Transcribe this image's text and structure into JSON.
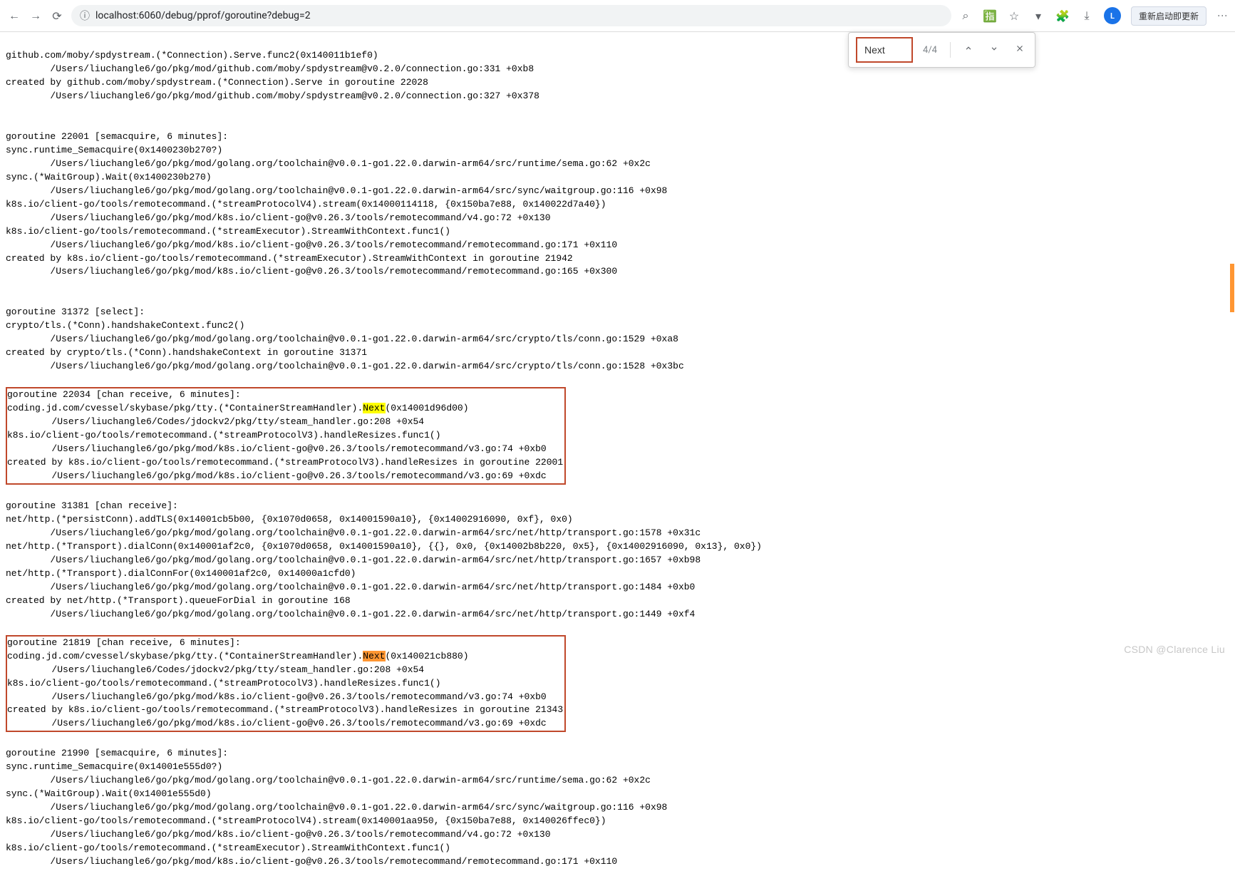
{
  "chrome": {
    "url": "localhost:6060/debug/pprof/goroutine?debug=2",
    "relaunch_label": "重新启动即更新"
  },
  "find": {
    "query": "Next",
    "count": "4/4"
  },
  "watermark": "CSDN @Clarence Liu",
  "blocks": {
    "g0": "github.com/moby/spdystream.(*Connection).Serve.func2(0x140011b1ef0)\n        /Users/liuchangle6/go/pkg/mod/github.com/moby/spdystream@v0.2.0/connection.go:331 +0xb8\ncreated by github.com/moby/spdystream.(*Connection).Serve in goroutine 22028\n        /Users/liuchangle6/go/pkg/mod/github.com/moby/spdystream@v0.2.0/connection.go:327 +0x378",
    "g1": "goroutine 22001 [semacquire, 6 minutes]:\nsync.runtime_Semacquire(0x1400230b270?)\n        /Users/liuchangle6/go/pkg/mod/golang.org/toolchain@v0.0.1-go1.22.0.darwin-arm64/src/runtime/sema.go:62 +0x2c\nsync.(*WaitGroup).Wait(0x1400230b270)\n        /Users/liuchangle6/go/pkg/mod/golang.org/toolchain@v0.0.1-go1.22.0.darwin-arm64/src/sync/waitgroup.go:116 +0x98\nk8s.io/client-go/tools/remotecommand.(*streamProtocolV4).stream(0x14000114118, {0x150ba7e88, 0x140022d7a40})\n        /Users/liuchangle6/go/pkg/mod/k8s.io/client-go@v0.26.3/tools/remotecommand/v4.go:72 +0x130\nk8s.io/client-go/tools/remotecommand.(*streamExecutor).StreamWithContext.func1()\n        /Users/liuchangle6/go/pkg/mod/k8s.io/client-go@v0.26.3/tools/remotecommand/remotecommand.go:171 +0x110\ncreated by k8s.io/client-go/tools/remotecommand.(*streamExecutor).StreamWithContext in goroutine 21942\n        /Users/liuchangle6/go/pkg/mod/k8s.io/client-go@v0.26.3/tools/remotecommand/remotecommand.go:165 +0x300",
    "g2": "goroutine 31372 [select]:\ncrypto/tls.(*Conn).handshakeContext.func2()\n        /Users/liuchangle6/go/pkg/mod/golang.org/toolchain@v0.0.1-go1.22.0.darwin-arm64/src/crypto/tls/conn.go:1529 +0xa8\ncreated by crypto/tls.(*Conn).handshakeContext in goroutine 31371\n        /Users/liuchangle6/go/pkg/mod/golang.org/toolchain@v0.0.1-go1.22.0.darwin-arm64/src/crypto/tls/conn.go:1528 +0x3bc",
    "g3_pre": "goroutine 22034 [chan receive, 6 minutes]:\ncoding.jd.com/cvessel/skybase/pkg/tty.(*ContainerStreamHandler).",
    "g3_hit": "Next",
    "g3_post": "(0x14001d96d00)\n        /Users/liuchangle6/Codes/jdockv2/pkg/tty/steam_handler.go:208 +0x54\nk8s.io/client-go/tools/remotecommand.(*streamProtocolV3).handleResizes.func1()\n        /Users/liuchangle6/go/pkg/mod/k8s.io/client-go@v0.26.3/tools/remotecommand/v3.go:74 +0xb0\ncreated by k8s.io/client-go/tools/remotecommand.(*streamProtocolV3).handleResizes in goroutine 22001\n        /Users/liuchangle6/go/pkg/mod/k8s.io/client-go@v0.26.3/tools/remotecommand/v3.go:69 +0xdc",
    "g4": "goroutine 31381 [chan receive]:\nnet/http.(*persistConn).addTLS(0x14001cb5b00, {0x1070d0658, 0x14001590a10}, {0x14002916090, 0xf}, 0x0)\n        /Users/liuchangle6/go/pkg/mod/golang.org/toolchain@v0.0.1-go1.22.0.darwin-arm64/src/net/http/transport.go:1578 +0x31c\nnet/http.(*Transport).dialConn(0x140001af2c0, {0x1070d0658, 0x14001590a10}, {{}, 0x0, {0x14002b8b220, 0x5}, {0x14002916090, 0x13}, 0x0})\n        /Users/liuchangle6/go/pkg/mod/golang.org/toolchain@v0.0.1-go1.22.0.darwin-arm64/src/net/http/transport.go:1657 +0xb98\nnet/http.(*Transport).dialConnFor(0x140001af2c0, 0x14000a1cfd0)\n        /Users/liuchangle6/go/pkg/mod/golang.org/toolchain@v0.0.1-go1.22.0.darwin-arm64/src/net/http/transport.go:1484 +0xb0\ncreated by net/http.(*Transport).queueForDial in goroutine 168\n        /Users/liuchangle6/go/pkg/mod/golang.org/toolchain@v0.0.1-go1.22.0.darwin-arm64/src/net/http/transport.go:1449 +0xf4",
    "g5_pre": "goroutine 21819 [chan receive, 6 minutes]:\ncoding.jd.com/cvessel/skybase/pkg/tty.(*ContainerStreamHandler).",
    "g5_hit": "Next",
    "g5_post": "(0x140021cb880)\n        /Users/liuchangle6/Codes/jdockv2/pkg/tty/steam_handler.go:208 +0x54\nk8s.io/client-go/tools/remotecommand.(*streamProtocolV3).handleResizes.func1()\n        /Users/liuchangle6/go/pkg/mod/k8s.io/client-go@v0.26.3/tools/remotecommand/v3.go:74 +0xb0\ncreated by k8s.io/client-go/tools/remotecommand.(*streamProtocolV3).handleResizes in goroutine 21343\n        /Users/liuchangle6/go/pkg/mod/k8s.io/client-go@v0.26.3/tools/remotecommand/v3.go:69 +0xdc",
    "g6": "goroutine 21990 [semacquire, 6 minutes]:\nsync.runtime_Semacquire(0x14001e555d0?)\n        /Users/liuchangle6/go/pkg/mod/golang.org/toolchain@v0.0.1-go1.22.0.darwin-arm64/src/runtime/sema.go:62 +0x2c\nsync.(*WaitGroup).Wait(0x14001e555d0)\n        /Users/liuchangle6/go/pkg/mod/golang.org/toolchain@v0.0.1-go1.22.0.darwin-arm64/src/sync/waitgroup.go:116 +0x98\nk8s.io/client-go/tools/remotecommand.(*streamProtocolV4).stream(0x140001aa950, {0x150ba7e88, 0x140026ffec0})\n        /Users/liuchangle6/go/pkg/mod/k8s.io/client-go@v0.26.3/tools/remotecommand/v4.go:72 +0x130\nk8s.io/client-go/tools/remotecommand.(*streamExecutor).StreamWithContext.func1()\n        /Users/liuchangle6/go/pkg/mod/k8s.io/client-go@v0.26.3/tools/remotecommand/remotecommand.go:171 +0x110"
  }
}
